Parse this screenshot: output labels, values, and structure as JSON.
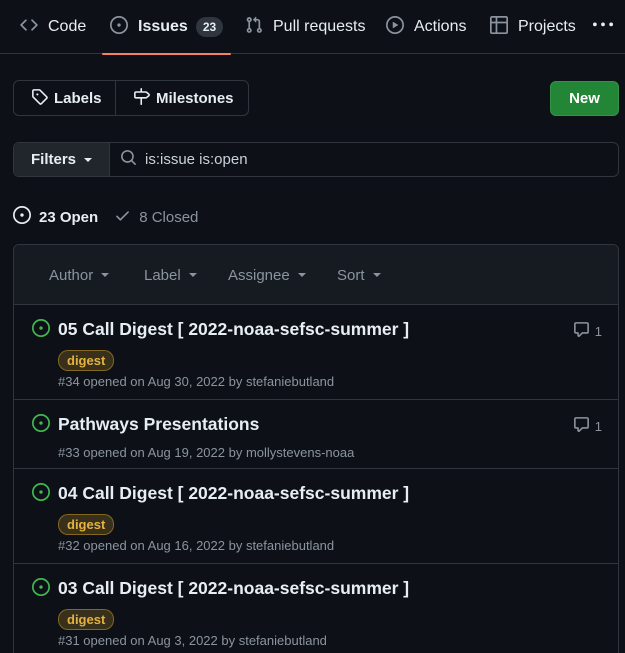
{
  "nav": {
    "tabs": [
      {
        "label": "Code",
        "icon": "code-icon"
      },
      {
        "label": "Issues",
        "icon": "issue-opened-icon",
        "count": "23"
      },
      {
        "label": "Pull requests",
        "icon": "git-pull-request-icon"
      },
      {
        "label": "Actions",
        "icon": "play-icon"
      },
      {
        "label": "Projects",
        "icon": "table-icon"
      }
    ],
    "more": "kebab-horizontal-icon"
  },
  "toolbar": {
    "labels": "Labels",
    "milestones": "Milestones",
    "new": "New"
  },
  "filter": {
    "button": "Filters",
    "query": "is:issue is:open"
  },
  "states": {
    "open": "23 Open",
    "closed": "8 Closed"
  },
  "header": {
    "author": "Author",
    "label": "Label",
    "assignee": "Assignee",
    "sort": "Sort"
  },
  "issues": [
    {
      "title": "05 Call Digest [ 2022-noaa-sefsc-summer ]",
      "label": "digest",
      "meta": "#34 opened on Aug 30, 2022 by stefaniebutland",
      "comments": "1"
    },
    {
      "title": "Pathways Presentations",
      "label": "",
      "meta": "#33 opened on Aug 19, 2022 by mollystevens-noaa",
      "comments": "1"
    },
    {
      "title": "04 Call Digest [ 2022-noaa-sefsc-summer ]",
      "label": "digest",
      "meta": "#32 opened on Aug 16, 2022 by stefaniebutland",
      "comments": ""
    },
    {
      "title": "03 Call Digest [ 2022-noaa-sefsc-summer ]",
      "label": "digest",
      "meta": "#31 opened on Aug 3, 2022 by stefaniebutland",
      "comments": ""
    }
  ],
  "colors": {
    "background": "#0d1117",
    "accent_underline": "#f78166",
    "new_button": "#238636",
    "open_icon": "#3fb950",
    "label_text": "#e3b341"
  }
}
